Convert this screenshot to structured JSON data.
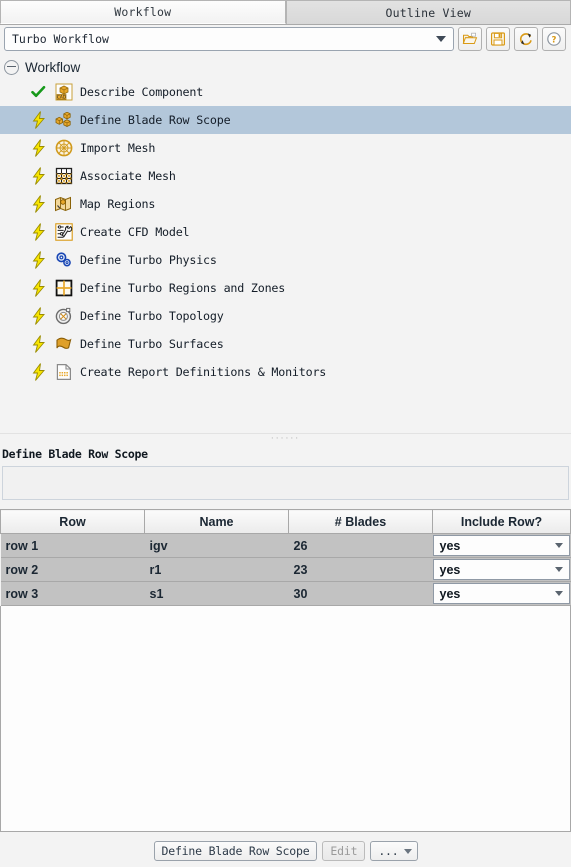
{
  "tabs": [
    {
      "label": "Workflow",
      "active": true
    },
    {
      "label": "Outline View",
      "active": false
    }
  ],
  "toolbar": {
    "workflow_select_value": "Turbo Workflow",
    "buttons": [
      {
        "name": "open-workflow-button",
        "icon": "folder-open-icon"
      },
      {
        "name": "save-workflow-button",
        "icon": "save-icon"
      },
      {
        "name": "reset-workflow-button",
        "icon": "refresh-icon"
      },
      {
        "name": "help-button",
        "icon": "help-icon"
      }
    ]
  },
  "tree": {
    "root_label": "Workflow",
    "items": [
      {
        "label": "Describe Component",
        "status": "check",
        "icon": "cad-box-icon",
        "selected": false
      },
      {
        "label": "Define Blade Row Scope",
        "status": "bolt",
        "icon": "blade-row-boxes-icon",
        "selected": true
      },
      {
        "label": "Import Mesh",
        "status": "bolt",
        "icon": "mesh-sphere-icon",
        "selected": false
      },
      {
        "label": "Associate Mesh",
        "status": "bolt",
        "icon": "mesh-grid-icon",
        "selected": false
      },
      {
        "label": "Map Regions",
        "status": "bolt",
        "icon": "map-regions-icon",
        "selected": false
      },
      {
        "label": "Create CFD Model",
        "status": "bolt",
        "icon": "cfd-wrench-icon",
        "selected": false
      },
      {
        "label": "Define Turbo Physics",
        "status": "bolt",
        "icon": "physics-gears-icon",
        "selected": false
      },
      {
        "label": "Define Turbo Regions and Zones",
        "status": "bolt",
        "icon": "regions-grid-icon",
        "selected": false
      },
      {
        "label": "Define Turbo Topology",
        "status": "bolt",
        "icon": "topology-disc-icon",
        "selected": false
      },
      {
        "label": "Define Turbo Surfaces",
        "status": "bolt",
        "icon": "surfaces-sheet-icon",
        "selected": false
      },
      {
        "label": "Create Report Definitions & Monitors",
        "status": "bolt",
        "icon": "report-page-icon",
        "selected": false
      }
    ]
  },
  "panel": {
    "title": "Define Blade Row Scope",
    "table": {
      "headers": [
        "Row",
        "Name",
        "# Blades",
        "Include Row?"
      ],
      "rows": [
        {
          "row": "row 1",
          "name": "igv",
          "blades": "26",
          "include": "yes"
        },
        {
          "row": "row 2",
          "name": "r1",
          "blades": "23",
          "include": "yes"
        },
        {
          "row": "row 3",
          "name": "s1",
          "blades": "30",
          "include": "yes"
        }
      ]
    }
  },
  "footer": {
    "primary_label": "Define Blade Row Scope",
    "edit_label": "Edit",
    "more_label": "..."
  },
  "colors": {
    "selection": "#b3c7da",
    "accent_orange": "#e3a423",
    "bolt_yellow": "#f5e000",
    "check_green": "#1f9b1f",
    "table_cell": "#c2c2c2"
  }
}
